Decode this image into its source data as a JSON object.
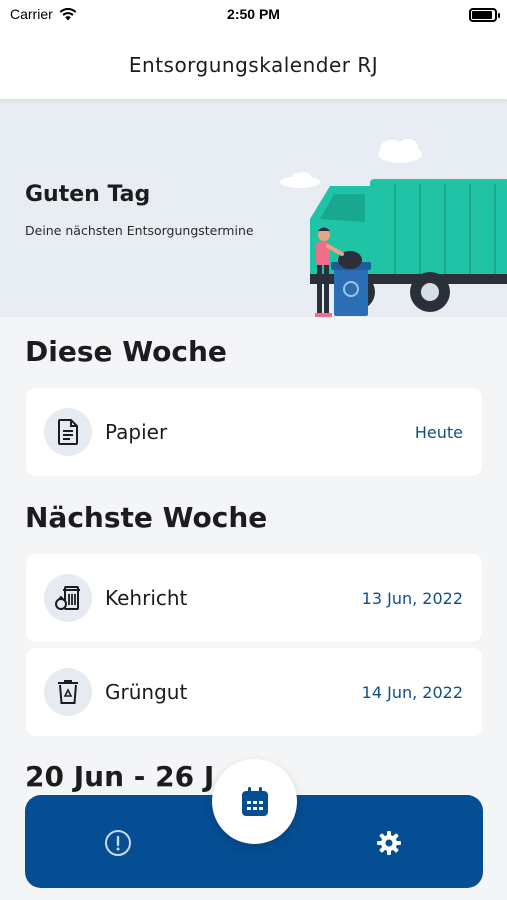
{
  "status_bar": {
    "carrier": "Carrier",
    "time": "2:50 PM"
  },
  "nav": {
    "title": "Entsorgungskalender RJ"
  },
  "hero": {
    "greeting": "Guten Tag",
    "subtitle": "Deine nächsten Entsorgungstermine"
  },
  "sections": {
    "this_week": {
      "title": "Diese Woche",
      "items": [
        {
          "label": "Papier",
          "date": "Heute",
          "icon": "document-icon"
        }
      ]
    },
    "next_week": {
      "title": "Nächste Woche",
      "items": [
        {
          "label": "Kehricht",
          "date": "13 Jun, 2022",
          "icon": "trash-bin-icon"
        },
        {
          "label": "Grüngut",
          "date": "14 Jun, 2022",
          "icon": "recycle-bin-icon"
        }
      ]
    },
    "later": {
      "title": "20 Jun - 26 J"
    }
  },
  "tab_bar": {
    "left_icon": "info-circle-icon",
    "center_icon": "calendar-icon",
    "right_icon": "gear-icon"
  },
  "colors": {
    "accent": "#054e94",
    "date_text": "#0e4f8c",
    "hero_bg": "#e7edf2",
    "truck": "#1fc4a6"
  }
}
